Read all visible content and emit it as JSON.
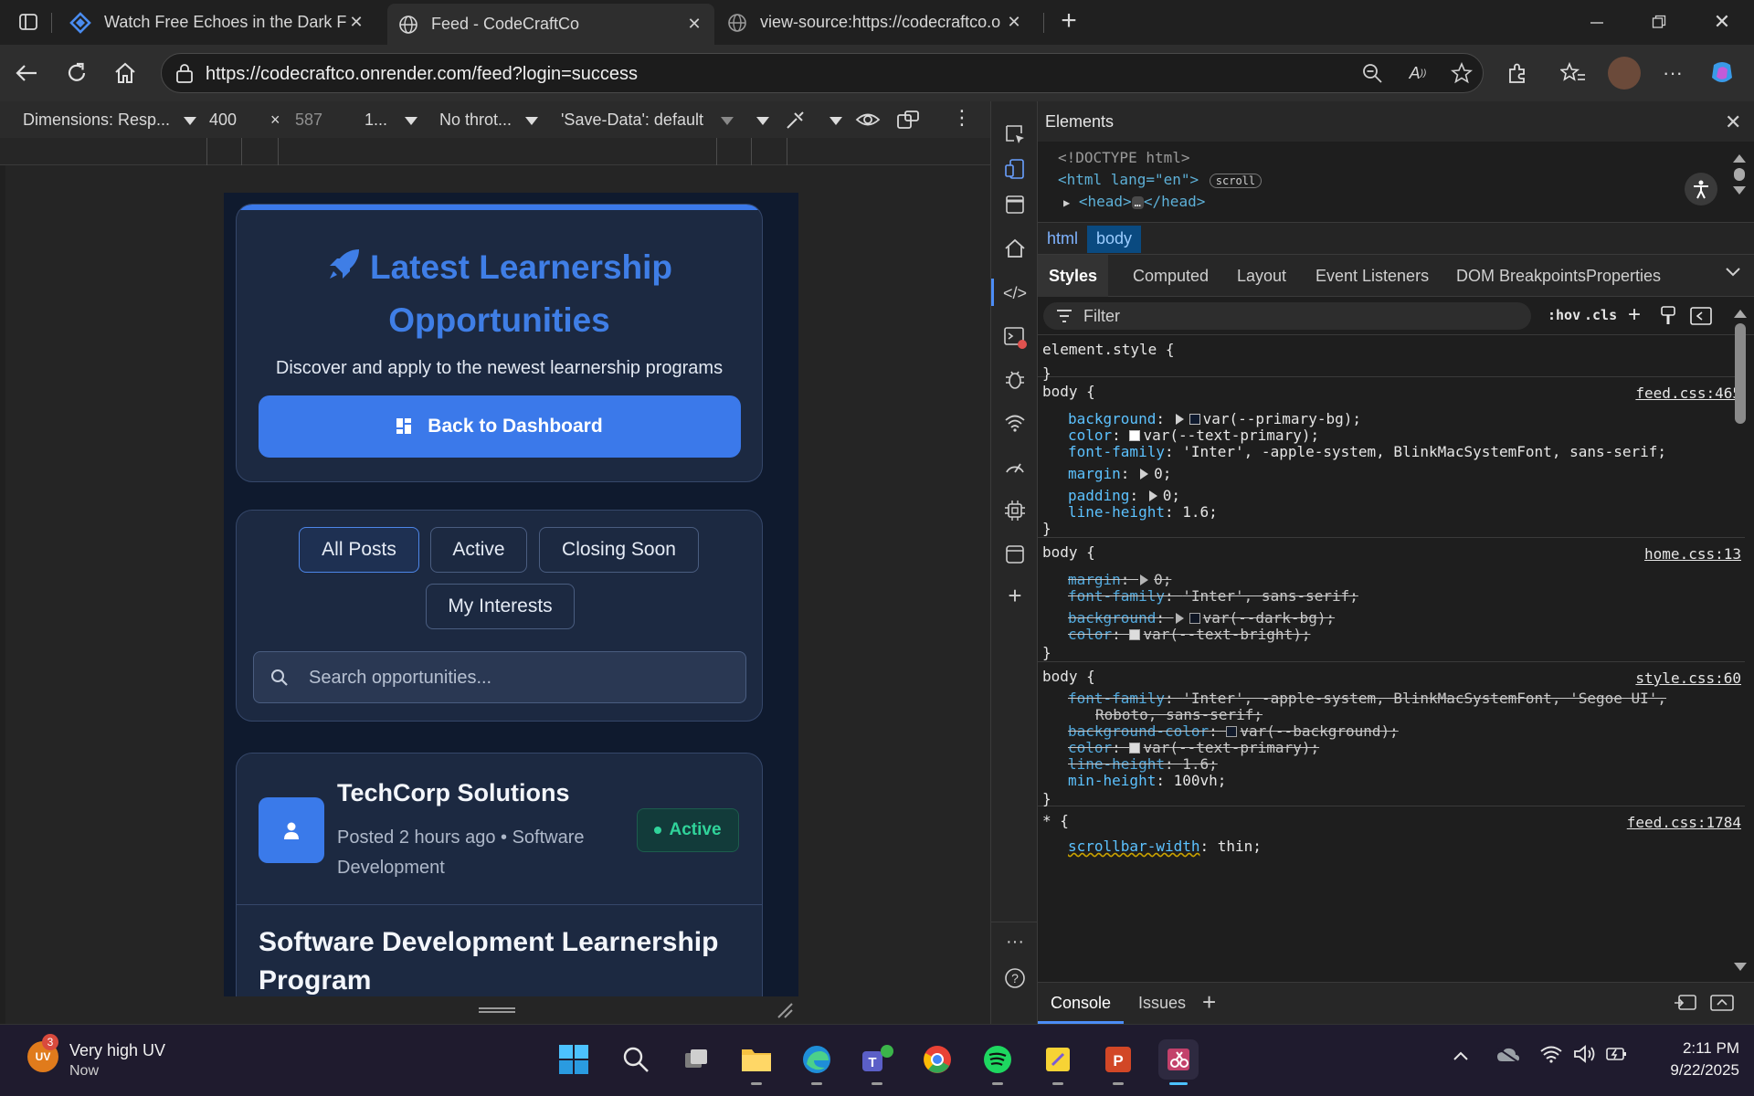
{
  "browser": {
    "tabs": [
      {
        "title": "Watch Free Echoes in the Dark Fu",
        "icon": "codecraft-logo-icon"
      },
      {
        "title": "Feed - CodeCraftCo",
        "icon": "globe-icon"
      },
      {
        "title": "view-source:https://codecraftco.o",
        "icon": "globe-icon"
      }
    ],
    "url": "https://codecraftco.onrender.com/feed?login=success"
  },
  "device_toolbar": {
    "dimensions": "Dimensions: Resp...",
    "width": "400",
    "times": "×",
    "height": "587",
    "zoom": "1...",
    "throttle": "No throt...",
    "save_data": "'Save-Data': default"
  },
  "page": {
    "hero_title": "Latest Learnership Opportunities",
    "hero_subtitle": "Discover and apply to the newest learnership programs",
    "back_button": "Back to Dashboard",
    "filters": [
      "All Posts",
      "Active",
      "Closing Soon",
      "My Interests"
    ],
    "search_placeholder": "Search opportunities...",
    "post": {
      "company": "TechCorp Solutions",
      "posted": "Posted 2 hours ago • Software Development",
      "status": "Active",
      "program_title": "Software Development Learnership Program"
    }
  },
  "devtools": {
    "panel_title": "Elements",
    "dom": {
      "doctype": "<!DOCTYPE html>",
      "html_open": "<html lang=\"en\">",
      "scroll_badge": "scroll",
      "head_collapsed": "<head>",
      "head_close": "</head>",
      "ellipsis": "…"
    },
    "breadcrumbs": [
      "html",
      "body"
    ],
    "subtabs": [
      "Styles",
      "Computed",
      "Layout",
      "Event Listeners",
      "DOM Breakpoints",
      "Properties"
    ],
    "filter_placeholder": "Filter",
    "hov": ":hov",
    "cls": ".cls",
    "rules": [
      {
        "selector": "element.style {",
        "close": "}"
      },
      {
        "selector": "body {",
        "source": "feed.css:465",
        "close": "}",
        "decls": [
          {
            "name": "background",
            "value": "var(--primary-bg);"
          },
          {
            "name": "color",
            "value": "var(--text-primary);"
          },
          {
            "name": "font-family",
            "value": "'Inter', -apple-system, BlinkMacSystemFont, sans-serif;"
          },
          {
            "name": "margin",
            "value": "0;"
          },
          {
            "name": "padding",
            "value": "0;"
          },
          {
            "name": "line-height",
            "value": "1.6;"
          }
        ]
      },
      {
        "selector": "body {",
        "source": "home.css:13",
        "close": "}",
        "decls": [
          {
            "name": "margin",
            "value": "0;"
          },
          {
            "name": "font-family",
            "value": "'Inter', sans-serif;"
          },
          {
            "name": "background",
            "value": "var(--dark-bg);"
          },
          {
            "name": "color",
            "value": "var(--text-bright);"
          }
        ]
      },
      {
        "selector": "body {",
        "source": "style.css:60",
        "close": "}",
        "decls": [
          {
            "name": "font-family",
            "value": "'Inter', -apple-system, BlinkMacSystemFont, 'Segoe UI',"
          },
          {
            "name": "",
            "value": "Roboto, sans-serif;"
          },
          {
            "name": "background-color",
            "value": "var(--background);"
          },
          {
            "name": "color",
            "value": "var(--text-primary);"
          },
          {
            "name": "line-height",
            "value": "1.6;"
          },
          {
            "name": "min-height",
            "value": "100vh;"
          }
        ]
      },
      {
        "selector": "* {",
        "source": "feed.css:1784",
        "decls": [
          {
            "name": "scrollbar-width",
            "value": "thin;"
          }
        ]
      }
    ],
    "drawer_tabs": [
      "Console",
      "Issues"
    ]
  },
  "taskbar": {
    "weather_badge": "3",
    "weather_avatar": "UV",
    "weather_title": "Very high UV",
    "weather_time": "Now",
    "time": "2:11 PM",
    "date": "9/22/2025"
  },
  "colors": {
    "accent": "#3b79ea",
    "status_green": "#30d39a",
    "page_bg": "#0f1a2e",
    "card_bg": "#1c2941"
  }
}
